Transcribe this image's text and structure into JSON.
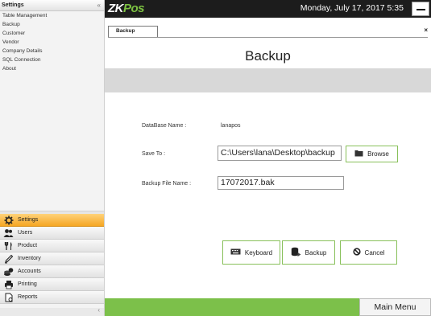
{
  "sidebar": {
    "title": "Settings",
    "collapse_glyph": "«",
    "items": [
      {
        "label": "Table Management"
      },
      {
        "label": "Backup"
      },
      {
        "label": "Customer"
      },
      {
        "label": "Vendor"
      },
      {
        "label": "Company Details"
      },
      {
        "label": "SQL Connection"
      },
      {
        "label": "About"
      }
    ],
    "modules": [
      {
        "label": "Settings",
        "icon": "gear-icon",
        "active": true
      },
      {
        "label": "Users",
        "icon": "users-icon"
      },
      {
        "label": "Product",
        "icon": "fork-knife-icon"
      },
      {
        "label": "Inventory",
        "icon": "pencil-icon"
      },
      {
        "label": "Accounts",
        "icon": "coins-icon"
      },
      {
        "label": "Printing",
        "icon": "printer-icon"
      },
      {
        "label": "Reports",
        "icon": "report-icon"
      }
    ],
    "bottom_glyph": "‹"
  },
  "header": {
    "logo_prefix": "ZK",
    "logo_suffix": "Pos",
    "datetime": "Monday, July 17, 2017 5:35"
  },
  "tab": {
    "label": "Backup",
    "close": "×"
  },
  "page": {
    "title": "Backup"
  },
  "form": {
    "database_label": "DataBase Name :",
    "database_value": "lanapos",
    "save_to_label": "Save To :",
    "save_to_value": "C:\\Users\\lana\\Desktop\\backup",
    "browse_label": "Browse",
    "filename_label": "Backup File Name :",
    "filename_value": "17072017.bak"
  },
  "actions": {
    "keyboard_label": "Keyboard",
    "backup_label": "Backup",
    "cancel_label": "Cancel"
  },
  "footer": {
    "main_menu_label": "Main Menu"
  },
  "colors": {
    "accent_green": "#7cc04a",
    "active_orange": "#f5a623",
    "topbar": "#1c1c1c"
  }
}
